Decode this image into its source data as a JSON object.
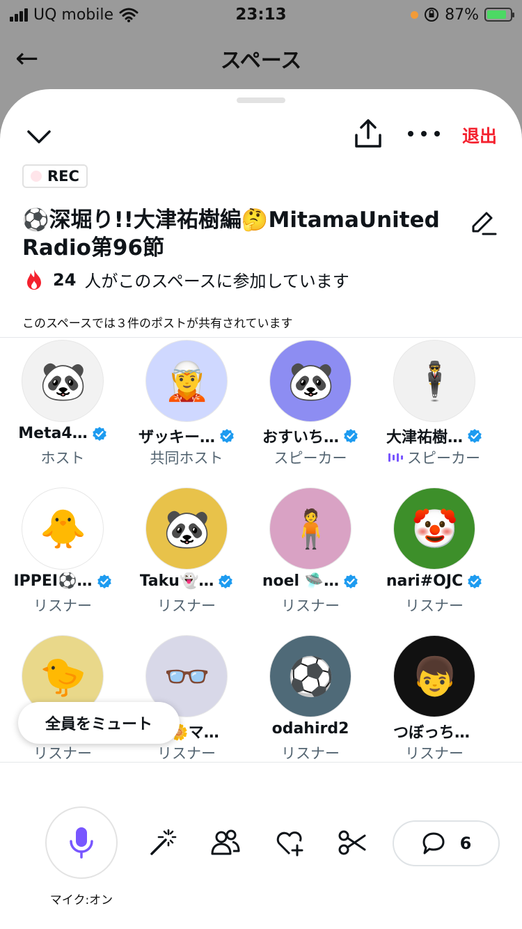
{
  "status_bar": {
    "carrier": "UQ mobile",
    "time": "23:13",
    "battery_percent": "87%"
  },
  "page": {
    "title": "スペース"
  },
  "sheet": {
    "leave_label": "退出",
    "rec_label": "REC",
    "title": "⚽深堀り!!大津祐樹編🤔MitamaUnited Radio第96節",
    "listener_count": "24",
    "listener_text": "人がこのスペースに参加しています",
    "shared_posts_text": "このスペースでは３件のポストが共有されています",
    "mute_all_label": "全員をミュート"
  },
  "participants": [
    {
      "name": "Meta4…",
      "role": "ホスト",
      "verified": true,
      "glyph": "🐼",
      "bg": "#f2f2f2",
      "speaking": false
    },
    {
      "name": "ザッキー…",
      "role": "共同ホスト",
      "verified": true,
      "glyph": "🧝",
      "bg": "#cfd8ff",
      "speaking": false
    },
    {
      "name": "おすいち…",
      "role": "スピーカー",
      "verified": true,
      "glyph": "🐼",
      "bg": "#8d8df2",
      "speaking": false
    },
    {
      "name": "大津祐樹…",
      "role": "スピーカー",
      "verified": true,
      "glyph": "🕴",
      "bg": "#f1f1f1",
      "speaking": true
    },
    {
      "name": "IPPEI⚽…",
      "role": "リスナー",
      "verified": true,
      "glyph": "🐥",
      "bg": "#ffffff",
      "speaking": false
    },
    {
      "name": "Taku👻…",
      "role": "リスナー",
      "verified": true,
      "glyph": "🐼",
      "bg": "#e8c24a",
      "speaking": false
    },
    {
      "name": "noel 🛸…",
      "role": "リスナー",
      "verified": true,
      "glyph": "🧍",
      "bg": "#d9a2c4",
      "speaking": false
    },
    {
      "name": "nari#OJC",
      "role": "リスナー",
      "verified": true,
      "glyph": "🤡",
      "bg": "#3d8f2a",
      "speaking": false
    },
    {
      "name": "",
      "role": "リスナー",
      "verified": false,
      "glyph": "🐤",
      "bg": "#e9d88a",
      "speaking": false
    },
    {
      "name": "こ🌼マ…",
      "role": "リスナー",
      "verified": false,
      "glyph": "👓",
      "bg": "#d8d8e8",
      "speaking": false
    },
    {
      "name": "odahird2",
      "role": "リスナー",
      "verified": false,
      "glyph": "⚽",
      "bg": "#4f6a78",
      "speaking": false
    },
    {
      "name": "つぼっち⚽…",
      "role": "リスナー",
      "verified": false,
      "glyph": "👦",
      "bg": "#111111",
      "speaking": false
    }
  ],
  "controls": {
    "mic_label": "マイク:オン",
    "reply_count": "6"
  },
  "colors": {
    "accent_purple": "#7856ff",
    "leave_red": "#f4212e",
    "verified_blue": "#1d9bf0",
    "flame": "#f4212e"
  }
}
